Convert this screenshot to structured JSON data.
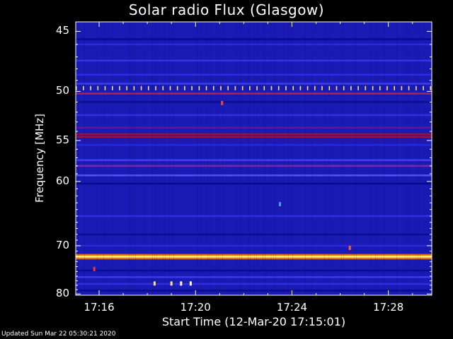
{
  "chart_data": {
    "type": "heatmap",
    "title": "Solar radio Flux (Glasgow)",
    "xlabel": "Start Time (12-Mar-20 17:15:01)",
    "ylabel": "Frequency [MHz]",
    "x_ticks": [
      "17:16",
      "17:20",
      "17:24",
      "17:28"
    ],
    "x_tick_minutes": [
      16,
      20,
      24,
      28
    ],
    "x_range_minutes": [
      15.03,
      29.8
    ],
    "y_ticks": [
      45,
      50,
      55,
      60,
      70,
      80
    ],
    "y_range": [
      44.3,
      80.3
    ],
    "y_scale": "reciprocal",
    "background_color": "#1a1ab4",
    "bands": [
      {
        "freq": 45.6,
        "color": "#0a0a9a"
      },
      {
        "freq": 46.0,
        "color": "#2a2ad8"
      },
      {
        "freq": 47.3,
        "color": "#3434e6"
      },
      {
        "freq": 48.5,
        "color": "#2e2ee0"
      },
      {
        "freq": 49.3,
        "color": "#3c3cee"
      },
      {
        "freq": 50.2,
        "color": "#b0205a"
      },
      {
        "freq": 51.0,
        "color": "#0c0c96"
      },
      {
        "freq": 52.3,
        "color": "#3030e6"
      },
      {
        "freq": 53.6,
        "color": "#5a1aa0"
      },
      {
        "freq": 54.3,
        "color": "#a01034"
      },
      {
        "freq": 54.6,
        "color": "#a51030"
      },
      {
        "freq": 55.5,
        "color": "#2828dc"
      },
      {
        "freq": 57.3,
        "color": "#4040ee"
      },
      {
        "freq": 58.0,
        "color": "#7a2aa8"
      },
      {
        "freq": 59.2,
        "color": "#5050f0"
      },
      {
        "freq": 60.3,
        "color": "#0a0a90"
      },
      {
        "freq": 65.0,
        "color": "#3030e0"
      },
      {
        "freq": 68.0,
        "color": "#0c0c90"
      },
      {
        "freq": 70.0,
        "color": "#2a2ad8"
      },
      {
        "freq": 71.7,
        "color": "#d86818"
      },
      {
        "freq": 72.0,
        "color": "#ffe040"
      },
      {
        "freq": 72.2,
        "color": "#fff8a0"
      },
      {
        "freq": 72.4,
        "color": "#e07018"
      },
      {
        "freq": 74.8,
        "color": "#0c0c90"
      },
      {
        "freq": 76.2,
        "color": "#3a3aea"
      },
      {
        "freq": 77.7,
        "color": "#3030e0"
      },
      {
        "freq": 79.2,
        "color": "#0c0c8c"
      }
    ],
    "periodic_spikes": {
      "freq": 49.7,
      "start_minute": 15.05,
      "interval_minutes": 0.3,
      "color": "#ffe060"
    },
    "spots": [
      {
        "minute": 21.1,
        "freq": 51.1,
        "color": "#ff4030"
      },
      {
        "minute": 23.5,
        "freq": 63.2,
        "color": "#40a0ff"
      },
      {
        "minute": 26.4,
        "freq": 70.4,
        "color": "#ff6030"
      },
      {
        "minute": 15.8,
        "freq": 74.5,
        "color": "#ff3030"
      },
      {
        "minute": 18.3,
        "freq": 77.6,
        "color": "#ffe070"
      },
      {
        "minute": 19.0,
        "freq": 77.6,
        "color": "#ffe070"
      },
      {
        "minute": 19.4,
        "freq": 77.6,
        "color": "#ffffff"
      },
      {
        "minute": 19.8,
        "freq": 77.6,
        "color": "#ffffff"
      }
    ]
  },
  "footer": {
    "updated": "Updated Sun Mar 22 05:30:21 2020"
  }
}
